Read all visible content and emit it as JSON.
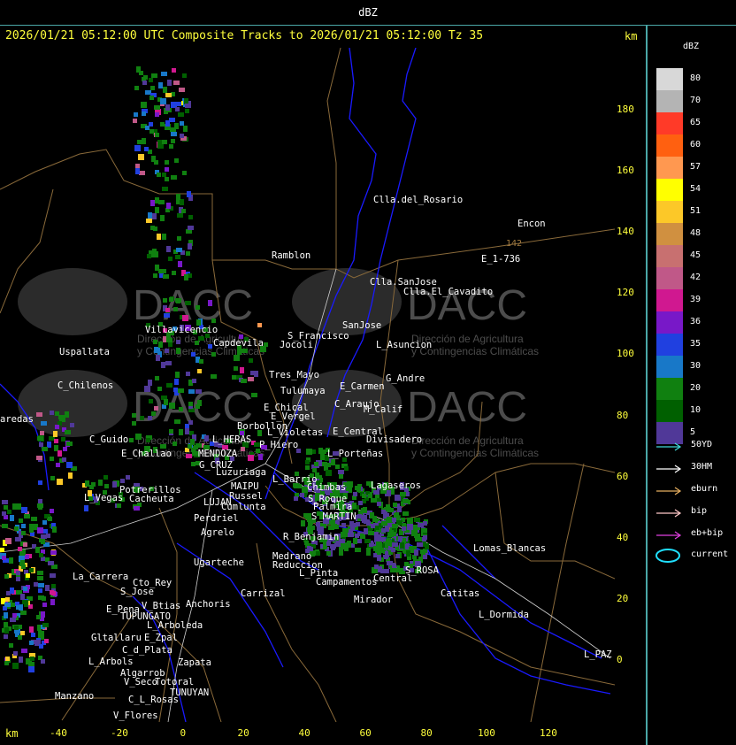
{
  "window": {
    "title": "dBZ"
  },
  "header": {
    "text": "2026/01/21 05:12:00 UTC Composite Tracks to 2026/01/21 05:12:00 Tz 35",
    "km_label": "km"
  },
  "x_axis": {
    "label": "km",
    "ticks": [
      "-40",
      "-20",
      "0",
      "20",
      "40",
      "60",
      "80",
      "100",
      "120"
    ]
  },
  "y_axis": {
    "ticks": [
      "180",
      "160",
      "140",
      "120",
      "100",
      "80",
      "60",
      "40",
      "20",
      "0"
    ]
  },
  "legend": {
    "title": "dBZ",
    "scale": [
      {
        "label": "80",
        "color": "#d8d8d8"
      },
      {
        "label": "70",
        "color": "#b4b4b4"
      },
      {
        "label": "65",
        "color": "#ff3a28"
      },
      {
        "label": "60",
        "color": "#ff6010"
      },
      {
        "label": "57",
        "color": "#ff9850"
      },
      {
        "label": "54",
        "color": "#ffff00"
      },
      {
        "label": "51",
        "color": "#fcc828"
      },
      {
        "label": "48",
        "color": "#d09040"
      },
      {
        "label": "45",
        "color": "#c87070"
      },
      {
        "label": "42",
        "color": "#c05888"
      },
      {
        "label": "39",
        "color": "#d01890"
      },
      {
        "label": "36",
        "color": "#7818c8"
      },
      {
        "label": "35",
        "color": "#2040e0"
      },
      {
        "label": "30",
        "color": "#1878c8"
      },
      {
        "label": "20",
        "color": "#108010"
      },
      {
        "label": "10",
        "color": "#006000"
      },
      {
        "label": "5",
        "color": "#503898"
      }
    ],
    "tracks": [
      {
        "label": "50YD",
        "color": "#40d8d8"
      },
      {
        "label": "30HM",
        "color": "#ffffff"
      },
      {
        "label": "eburn",
        "color": "#e8b060"
      },
      {
        "label": "bip",
        "color": "#ffc8c8"
      },
      {
        "label": "eb+bip",
        "color": "#e040e0"
      }
    ],
    "current": {
      "label": "current",
      "color": "#20e0ff"
    }
  },
  "watermark": {
    "text": "DACC",
    "subtitle_1": "Dirección de Agricultura",
    "subtitle_2": "y Contingencias Climáticas"
  },
  "map": {
    "route_label": "E_1-736",
    "route_number": "142",
    "cities": [
      {
        "name": "Clla.del_Rosario"
      },
      {
        "name": "Encon"
      },
      {
        "name": "Ramblon"
      },
      {
        "name": "Clla.SanJose"
      },
      {
        "name": "Clla.El_Cavadito"
      },
      {
        "name": "Villavicencio"
      },
      {
        "name": "Capdevila"
      },
      {
        "name": "S_Francisco"
      },
      {
        "name": "Jocoli"
      },
      {
        "name": "SanJose"
      },
      {
        "name": "L_Asuncion"
      },
      {
        "name": "Uspallata"
      },
      {
        "name": "Tres_Mayo"
      },
      {
        "name": "G_Andre"
      },
      {
        "name": "C_Chilenos"
      },
      {
        "name": "E_Carmen"
      },
      {
        "name": "Tulumaya"
      },
      {
        "name": "C_Araujo"
      },
      {
        "name": "E_Chical"
      },
      {
        "name": "M_Calif"
      },
      {
        "name": "E_Vergel"
      },
      {
        "name": "aredas"
      },
      {
        "name": "Borbollon"
      },
      {
        "name": "L_Violetas"
      },
      {
        "name": "E_Central"
      },
      {
        "name": "Divisadero"
      },
      {
        "name": "C_Guido"
      },
      {
        "name": "L_HERAS"
      },
      {
        "name": "P_Hiero"
      },
      {
        "name": "E_Challao"
      },
      {
        "name": "MENDOZA"
      },
      {
        "name": "L_Porteñas"
      },
      {
        "name": "G_CRUZ"
      },
      {
        "name": "Luzuriaga"
      },
      {
        "name": "L_Barrio"
      },
      {
        "name": "Chimbas"
      },
      {
        "name": "Lagaseros"
      },
      {
        "name": "Potrerillos"
      },
      {
        "name": "MAIPU"
      },
      {
        "name": "Russel"
      },
      {
        "name": "S_Roque"
      },
      {
        "name": "L_Vegas"
      },
      {
        "name": "Cacheuta"
      },
      {
        "name": "LUJAN"
      },
      {
        "name": "Cumlunta"
      },
      {
        "name": "Palmira"
      },
      {
        "name": "Perdriel"
      },
      {
        "name": "S_MARTIN"
      },
      {
        "name": "Agrelo"
      },
      {
        "name": "R_Benjamin"
      },
      {
        "name": "Lomas_Blancas"
      },
      {
        "name": "Ugarteche"
      },
      {
        "name": "Medrano"
      },
      {
        "name": "Reduccion"
      },
      {
        "name": "L_Pinta"
      },
      {
        "name": "S_ROSA"
      },
      {
        "name": "La_Carrera"
      },
      {
        "name": "Cto_Rey"
      },
      {
        "name": "S_Jose"
      },
      {
        "name": "Carrizal"
      },
      {
        "name": "Campamentos"
      },
      {
        "name": "Central"
      },
      {
        "name": "Catitas"
      },
      {
        "name": "V_Btias"
      },
      {
        "name": "E_Pena"
      },
      {
        "name": "Anchoris"
      },
      {
        "name": "Mirador"
      },
      {
        "name": "TUPUNGATO"
      },
      {
        "name": "L_Dormida"
      },
      {
        "name": "L_Arboleda"
      },
      {
        "name": "E_Zpal"
      },
      {
        "name": "Gltallaru"
      },
      {
        "name": "C_d_Plata"
      },
      {
        "name": "L_Arbols"
      },
      {
        "name": "Zapata"
      },
      {
        "name": "L_PAZ"
      },
      {
        "name": "Algarrob"
      },
      {
        "name": "V_Seco"
      },
      {
        "name": "Totoral"
      },
      {
        "name": "TUNUYAN"
      },
      {
        "name": "Manzano"
      },
      {
        "name": "C_L_Rosas"
      },
      {
        "name": "V_Flores"
      }
    ]
  }
}
